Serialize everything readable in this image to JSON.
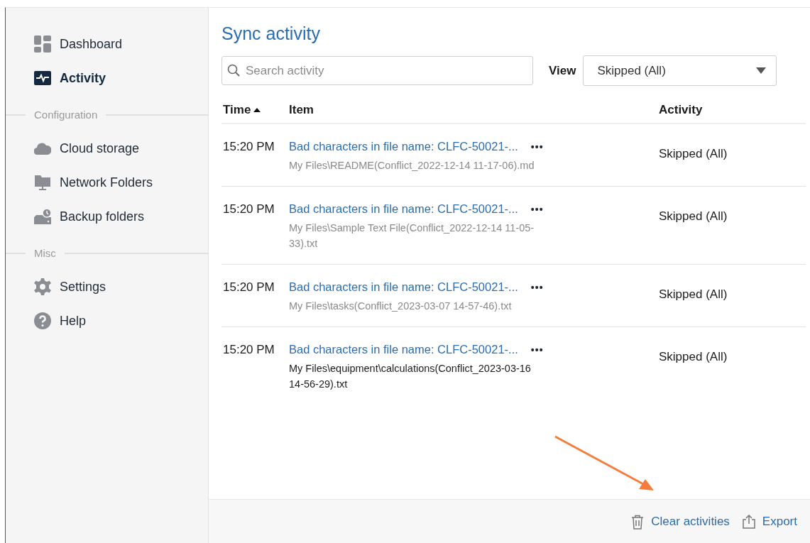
{
  "sidebar": {
    "groups": [
      {
        "items": [
          {
            "label": "Dashboard",
            "selected": false
          },
          {
            "label": "Activity",
            "selected": true
          }
        ]
      },
      {
        "heading": "Configuration",
        "items": [
          {
            "label": "Cloud storage",
            "selected": false
          },
          {
            "label": "Network Folders",
            "selected": false
          },
          {
            "label": "Backup folders",
            "selected": false
          }
        ]
      },
      {
        "heading": "Misc",
        "items": [
          {
            "label": "Settings",
            "selected": false
          },
          {
            "label": "Help",
            "selected": false
          }
        ]
      }
    ]
  },
  "main": {
    "title": "Sync activity",
    "search": {
      "placeholder": "Search activity"
    },
    "view": {
      "label": "View",
      "value": "Skipped (All)"
    },
    "table": {
      "columns": [
        {
          "label": "Time",
          "sorted": true,
          "ascending": true
        },
        {
          "label": "Item",
          "sorted": false
        },
        {
          "label": "Activity",
          "sorted": false
        }
      ],
      "rows": [
        {
          "time": "15:20 PM",
          "title": "Bad characters in file name: CLFC-50021-...",
          "more": "•••",
          "path": "My Files\\README(Conflict_2022-12-14 11-17-06).md",
          "highlighted": false,
          "activity": "Skipped (All)"
        },
        {
          "time": "15:20 PM",
          "title": "Bad characters in file name: CLFC-50021-...",
          "more": "•••",
          "path": "My Files\\Sample Text File(Conflict_2022-12-14 11-05-33).txt",
          "highlighted": false,
          "activity": "Skipped (All)"
        },
        {
          "time": "15:20 PM",
          "title": "Bad characters in file name: CLFC-50021-...",
          "more": "•••",
          "path": "My Files\\tasks(Conflict_2023-03-07 14-57-46).txt",
          "highlighted": false,
          "activity": "Skipped (All)"
        },
        {
          "time": "15:20 PM",
          "title": "Bad characters in file name: CLFC-50021-...",
          "more": "•••",
          "path": "My Files\\equipment\\calculations(Conflict_2023-03-16 14-56-29).txt",
          "highlighted": true,
          "activity": "Skipped (All)"
        }
      ]
    },
    "footer": {
      "actions": [
        {
          "label": "Clear activities"
        },
        {
          "label": "Export"
        }
      ]
    }
  }
}
